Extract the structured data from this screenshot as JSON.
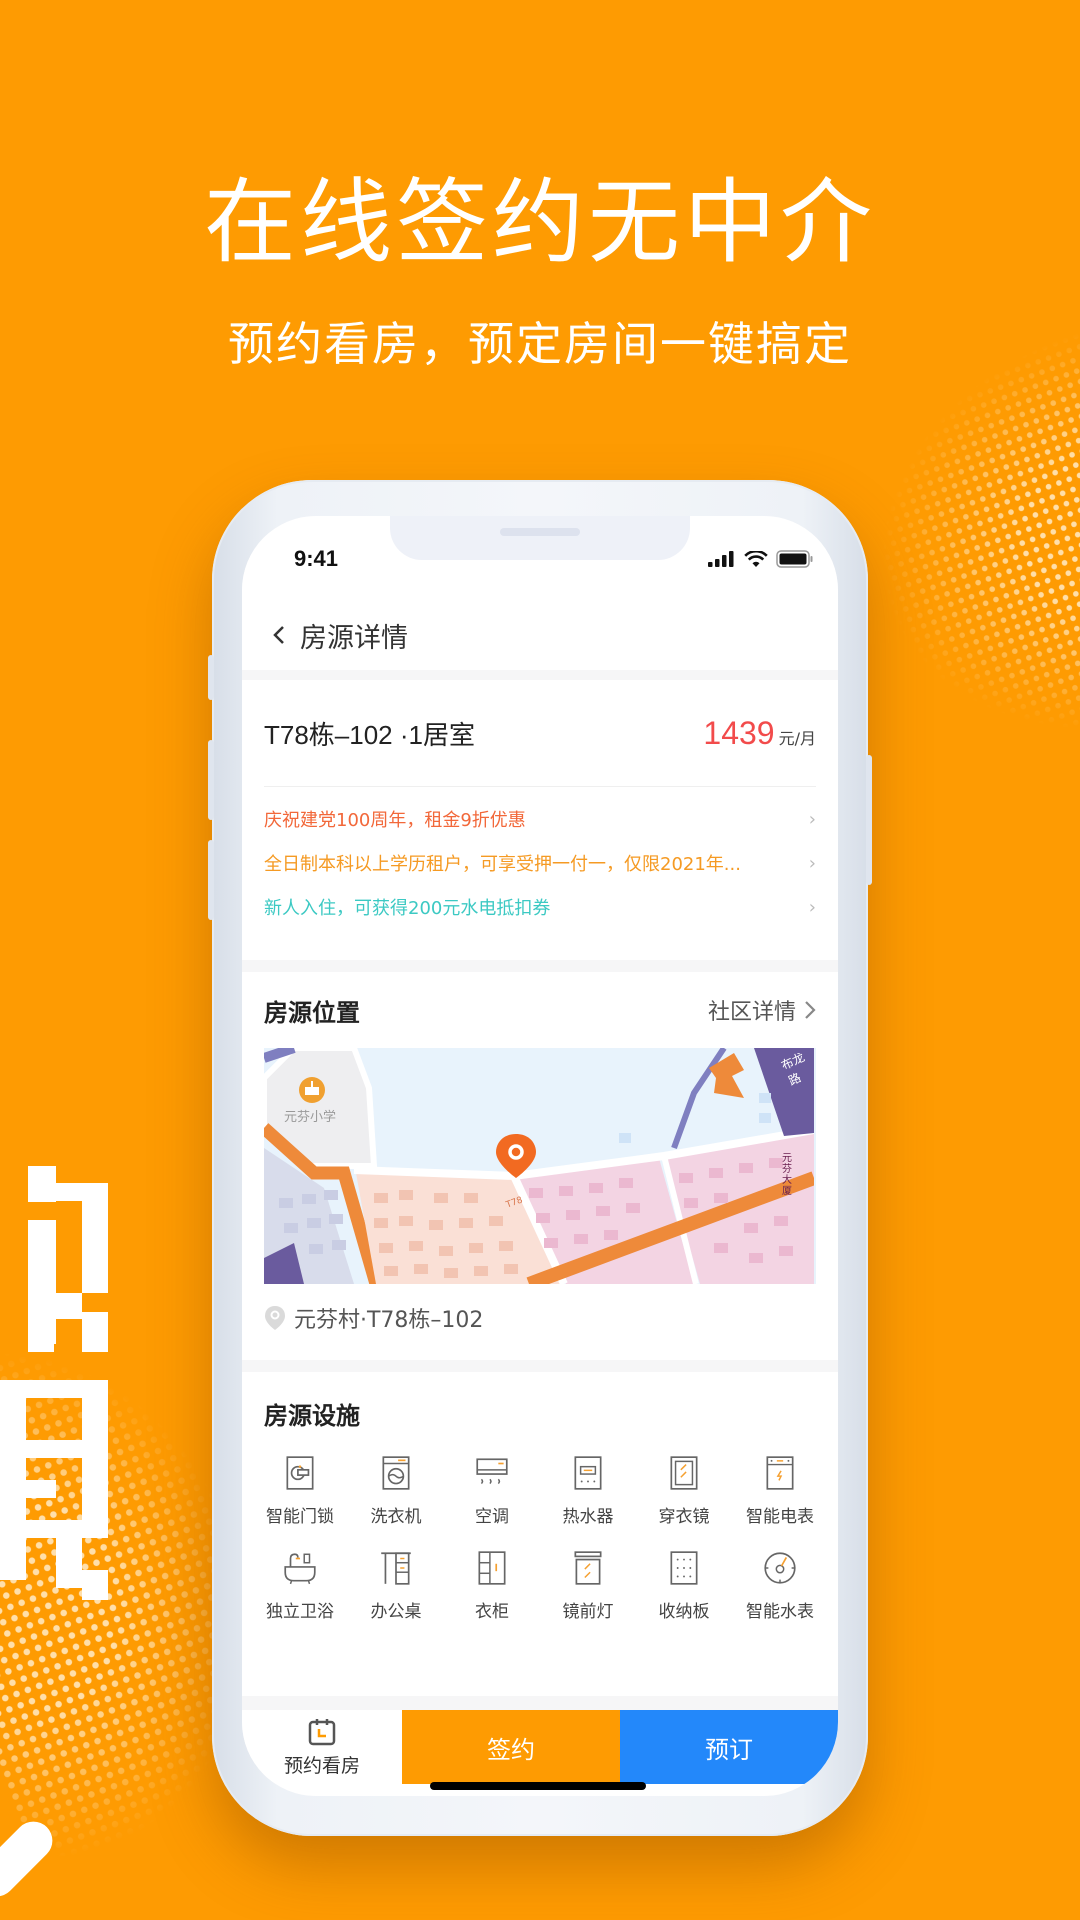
{
  "banner": {
    "headline": "在线签约无中介",
    "subline": "预约看房，预定房间一键搞定"
  },
  "status_bar": {
    "time": "9:41",
    "icons": [
      "signal-icon",
      "wifi-icon",
      "battery-icon"
    ]
  },
  "navbar": {
    "back_icon": "chevron-left-icon",
    "title": "房源详情"
  },
  "listing": {
    "title": "T78栋–102 ·1居室",
    "price": "1439",
    "price_unit": "元/月",
    "promotions": [
      {
        "text": "庆祝建党100周年，租金9折优惠",
        "color": "#F2683A"
      },
      {
        "text": "全日制本科以上学历租户，可享受押一付一，仅限2021年...",
        "color": "#F59A23"
      },
      {
        "text": "新人入住，可获得200元水电抵扣券",
        "color": "#3CC9C3"
      }
    ]
  },
  "location": {
    "section_title": "房源位置",
    "link_label": "社区详情",
    "map": {
      "school_label": "元芬小学",
      "road_label": "布龙路",
      "building_label": "元芬大厦",
      "marker_building": "T78"
    },
    "address": "元芬村·T78栋–102"
  },
  "facilities": {
    "section_title": "房源设施",
    "items": [
      {
        "label": "智能门锁",
        "icon": "smart-lock-icon"
      },
      {
        "label": "洗衣机",
        "icon": "washing-machine-icon"
      },
      {
        "label": "空调",
        "icon": "air-conditioner-icon"
      },
      {
        "label": "热水器",
        "icon": "water-heater-icon"
      },
      {
        "label": "穿衣镜",
        "icon": "mirror-icon"
      },
      {
        "label": "智能电表",
        "icon": "electric-meter-icon"
      },
      {
        "label": "独立卫浴",
        "icon": "bathtub-icon"
      },
      {
        "label": "办公桌",
        "icon": "desk-icon"
      },
      {
        "label": "衣柜",
        "icon": "wardrobe-icon"
      },
      {
        "label": "镜前灯",
        "icon": "mirror-light-icon"
      },
      {
        "label": "收纳板",
        "icon": "storage-board-icon"
      },
      {
        "label": "智能水表",
        "icon": "water-meter-icon"
      }
    ]
  },
  "bottom_bar": {
    "appointment_label": "预约看房",
    "sign_label": "签约",
    "book_label": "预订"
  },
  "colors": {
    "brand_orange": "#FE9B02",
    "book_blue": "#2388FA",
    "price_red": "#F24B4B"
  }
}
